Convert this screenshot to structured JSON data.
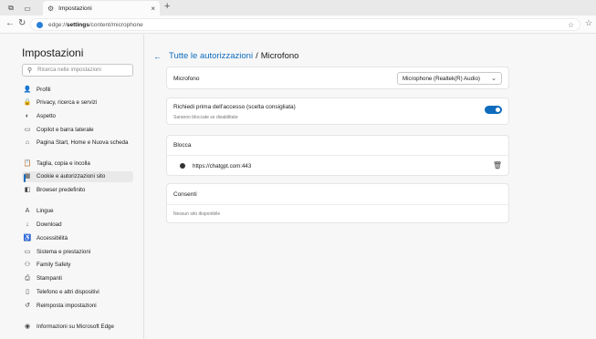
{
  "browser": {
    "tab_title": "Impostazioni",
    "tab_close": "×",
    "new_tab": "+",
    "url_prefix": "edge://",
    "url_strong": "settings",
    "url_rest": "/content/microphone",
    "icons": {
      "workspaces": "⧉",
      "tab_actions": "▭",
      "back": "←",
      "refresh": "↻",
      "favorite": "☆",
      "favorites": "☆"
    }
  },
  "sidebar": {
    "title": "Impostazioni",
    "search_placeholder": "Ricerca nelle impostazioni",
    "items": [
      {
        "label": "Profili",
        "icon": "profile-icon",
        "glyph": "👤"
      },
      {
        "label": "Privacy, ricerca e servizi",
        "icon": "lock-icon",
        "glyph": "🔒"
      },
      {
        "label": "Aspetto",
        "icon": "palette-icon",
        "glyph": "◐"
      },
      {
        "label": "Copilot e barra laterale",
        "icon": "sidebar-icon",
        "glyph": "▭"
      },
      {
        "label": "Pagina Start, Home e Nuova scheda",
        "icon": "home-icon",
        "glyph": "⌂"
      },
      {
        "label": "Taglia, copia e incolla",
        "icon": "clipboard-icon",
        "glyph": "📋"
      },
      {
        "label": "Cookie e autorizzazioni sito",
        "icon": "cookie-icon",
        "glyph": "▦"
      },
      {
        "label": "Browser predefinito",
        "icon": "browser-icon",
        "glyph": "◧"
      },
      {
        "label": "Lingue",
        "icon": "language-icon",
        "glyph": "A"
      },
      {
        "label": "Download",
        "icon": "download-icon",
        "glyph": "↓"
      },
      {
        "label": "Accessibilità",
        "icon": "accessibility-icon",
        "glyph": "♿"
      },
      {
        "label": "Sistema e prestazioni",
        "icon": "system-icon",
        "glyph": "▭"
      },
      {
        "label": "Family Safety",
        "icon": "family-icon",
        "glyph": "⚇"
      },
      {
        "label": "Stampanti",
        "icon": "printer-icon",
        "glyph": "⎙"
      },
      {
        "label": "Telefono e altri dispositivi",
        "icon": "phone-icon",
        "glyph": "▯"
      },
      {
        "label": "Reimposta impostazioni",
        "icon": "reset-icon",
        "glyph": "↺"
      },
      {
        "label": "Informazioni su Microsoft Edge",
        "icon": "edge-icon",
        "glyph": "◉"
      }
    ]
  },
  "main": {
    "breadcrumb_back": "←",
    "breadcrumb_link": "Tutte le autorizzazioni",
    "breadcrumb_sep": "/",
    "breadcrumb_current": "Microfono",
    "microphone_label": "Microfono",
    "microphone_device": "Microphone (Realtek(R) Audio)",
    "ask_label": "Richiedi prima dell'accesso (scelta consigliata)",
    "ask_sub": "Saranno bloccate se disabilitate",
    "ask_enabled": true,
    "block_label": "Blocca",
    "blocked_sites": [
      "https://chatgpt.com:443"
    ],
    "allow_label": "Consenti",
    "allow_empty": "Nessun sito disponibile"
  },
  "colors": {
    "accent": "#0f6cbd"
  }
}
